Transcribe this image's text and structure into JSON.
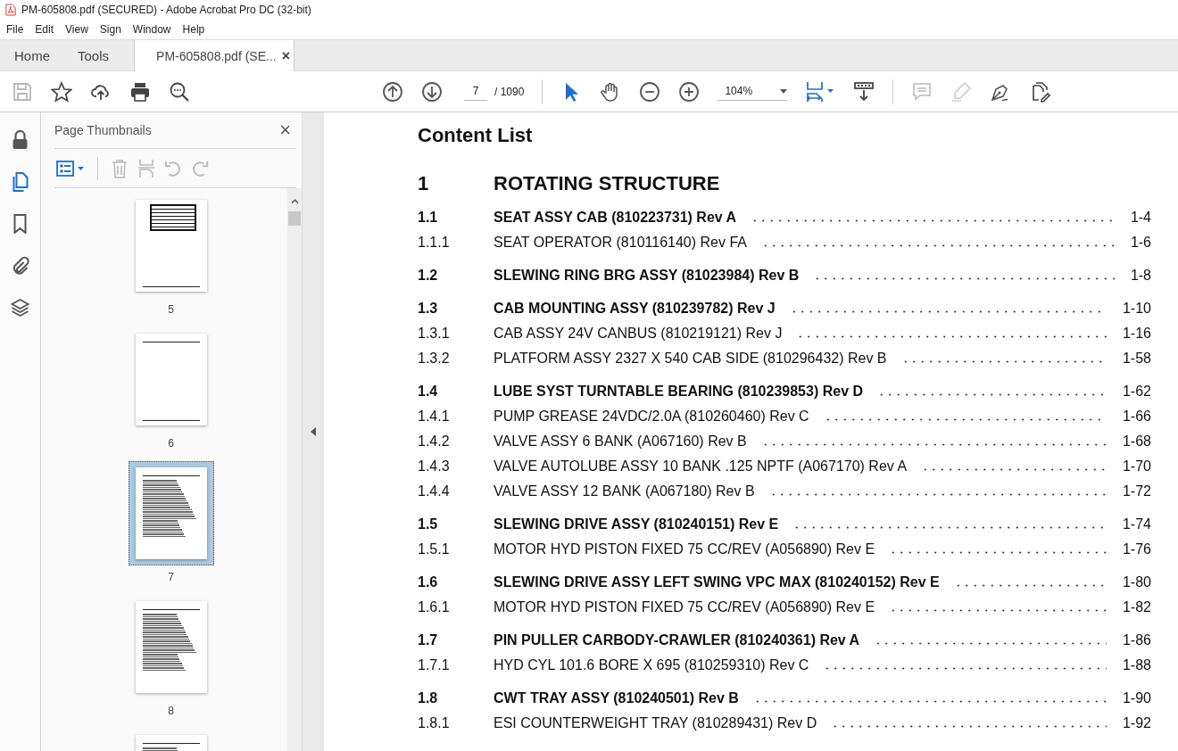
{
  "window": {
    "title": "PM-605808.pdf (SECURED) - Adobe Acrobat Pro DC (32-bit)"
  },
  "menu": [
    "File",
    "Edit",
    "View",
    "Sign",
    "Window",
    "Help"
  ],
  "tabs": [
    {
      "label": "Home",
      "kind": "nav",
      "selected": false
    },
    {
      "label": "Tools",
      "kind": "nav",
      "selected": false
    },
    {
      "label": "PM-605808.pdf (SE...",
      "kind": "document",
      "selected": true,
      "close": "×"
    }
  ],
  "toolbar": {
    "page": "7",
    "page_total": "/ 1090",
    "zoom": "104%"
  },
  "sidebar": {
    "rail": [
      {
        "kind": "lock",
        "selected": false
      },
      {
        "kind": "pages",
        "selected": true
      },
      {
        "kind": "bookmark",
        "selected": false
      },
      {
        "kind": "attachment",
        "selected": false
      },
      {
        "kind": "layers",
        "selected": false
      }
    ],
    "panel_title": "Page Thumbnails",
    "close": "×",
    "thumbnails": [
      {
        "label": "5",
        "kind": "table",
        "selected": false
      },
      {
        "label": "6",
        "kind": "blank",
        "selected": false
      },
      {
        "label": "7",
        "kind": "list",
        "selected": true
      },
      {
        "label": "8",
        "kind": "list",
        "selected": false
      },
      {
        "kind": "list",
        "selected": false
      }
    ]
  },
  "document": {
    "title": "Content List",
    "chapter": {
      "number": "1",
      "title": "ROTATING STRUCTURE"
    },
    "sections": [
      {
        "number": "1.1",
        "title": "SEAT ASSY CAB (810223731) Rev A",
        "page": "1-4",
        "items": [
          {
            "number": "1.1.1",
            "title": "SEAT OPERATOR (810116140) Rev FA",
            "page": "1-6"
          }
        ]
      },
      {
        "number": "1.2",
        "title": "SLEWING RING BRG ASSY (81023984) Rev B",
        "page": "1-8"
      },
      {
        "number": "1.3",
        "title": "CAB MOUNTING ASSY (810239782) Rev J",
        "page": "1-10",
        "items": [
          {
            "number": "1.3.1",
            "title": "CAB ASSY 24V CANBUS (810219121) Rev J",
            "page": "1-16"
          },
          {
            "number": "1.3.2",
            "title": "PLATFORM ASSY 2327 X 540 CAB SIDE (810296432) Rev B",
            "page": "1-58"
          }
        ]
      },
      {
        "number": "1.4",
        "title": "LUBE SYST TURNTABLE BEARING (810239853) Rev D",
        "page": "1-62",
        "items": [
          {
            "number": "1.4.1",
            "title": "PUMP GREASE 24VDC/2.0A (810260460) Rev C",
            "page": "1-66"
          },
          {
            "number": "1.4.2",
            "title": "VALVE ASSY 6 BANK (A067160) Rev B",
            "page": "1-68"
          },
          {
            "number": "1.4.3",
            "title": "VALVE AUTOLUBE ASSY 10 BANK .125 NPTF (A067170) Rev A",
            "page": "1-70"
          },
          {
            "number": "1.4.4",
            "title": "VALVE ASSY 12 BANK (A067180) Rev B",
            "page": "1-72"
          }
        ]
      },
      {
        "number": "1.5",
        "title": "SLEWING DRIVE ASSY (810240151) Rev E",
        "page": "1-74",
        "items": [
          {
            "number": "1.5.1",
            "title": "MOTOR HYD PISTON FIXED 75 CC/REV (A056890) Rev E",
            "page": "1-76"
          }
        ]
      },
      {
        "number": "1.6",
        "title": "SLEWING DRIVE ASSY LEFT SWING VPC MAX (810240152) Rev E",
        "page": "1-80",
        "items": [
          {
            "number": "1.6.1",
            "title": "MOTOR HYD PISTON FIXED 75 CC/REV (A056890) Rev E",
            "page": "1-82"
          }
        ]
      },
      {
        "number": "1.7",
        "title": "PIN PULLER CARBODY-CRAWLER (810240361) Rev A",
        "page": "1-86",
        "items": [
          {
            "number": "1.7.1",
            "title": "HYD CYL 101.6 BORE X 695 (810259310) Rev C",
            "page": "1-88"
          }
        ]
      },
      {
        "number": "1.8",
        "title": "CWT TRAY ASSY (810240501) Rev B",
        "page": "1-90",
        "items": [
          {
            "number": "1.8.1",
            "title": "ESI COUNTERWEIGHT TRAY (810289431) Rev D",
            "page": "1-92"
          }
        ]
      }
    ]
  }
}
